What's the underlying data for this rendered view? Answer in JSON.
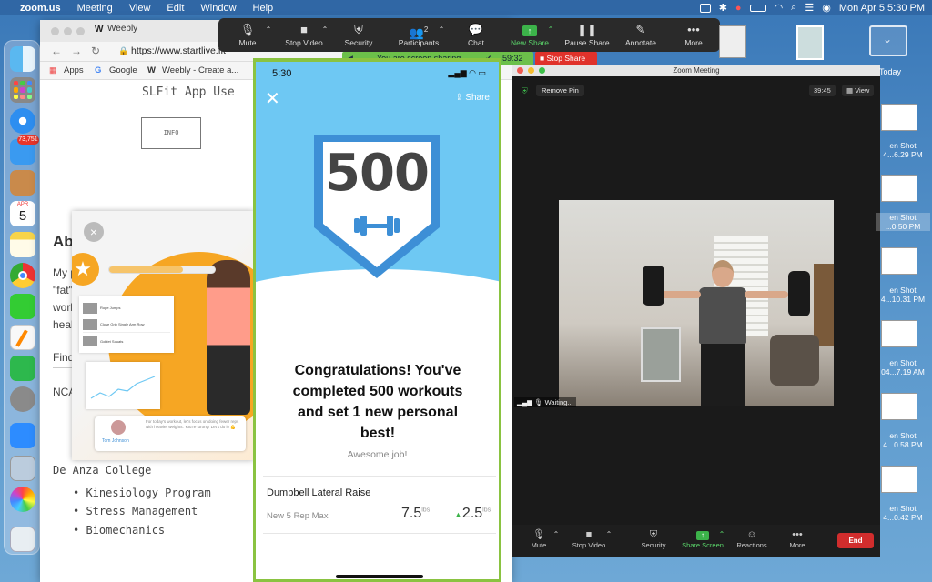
{
  "menubar": {
    "app_name": "zoom.us",
    "items": [
      "Meeting",
      "View",
      "Edit",
      "Window",
      "Help"
    ],
    "datetime": "Mon Apr 5  5:30 PM"
  },
  "dock": {
    "mail_badge": "73,751",
    "calendar_month": "APR",
    "calendar_day": "5"
  },
  "browser": {
    "tab_title": "Weebly",
    "url": "https://www.startlive.fit",
    "bookmarks": [
      "Apps",
      "Google",
      "Weebly - Create a..."
    ],
    "page": {
      "heading": "SLFit App Use",
      "info_button": "INFO",
      "about_fragment": "Ab",
      "body_fragments": [
        "My p",
        "\"fat\"",
        "work",
        "healt"
      ],
      "find_fragment": "Find",
      "ncaa_fragment": "NCAA",
      "college": "De Anza College",
      "programs": [
        "Kinesiology Program",
        "Stress Management",
        "Biomechanics"
      ]
    }
  },
  "popup": {
    "close": "×",
    "list_items": [
      "Rope Jumps",
      "Close Grip Single Arm Row",
      "Goblet Squats"
    ],
    "chat_text": "For today's workout, let's focus on doing fewer reps with heavier weights. You're strong! Let's do it! 💪",
    "trainer_name": "Tom Johnson"
  },
  "phone": {
    "time": "5:30",
    "share_label": "Share",
    "close_label": "✕",
    "badge_number": "500",
    "congrats_title": "Congratulations! You've completed 500 workouts and set 1 new personal best!",
    "subtitle": "Awesome job!",
    "exercise_name": "Dumbbell Lateral Raise",
    "metric_label": "New 5 Rep Max",
    "metric_value": "7.5",
    "metric_unit": "lbs",
    "change_value": "2.5",
    "change_unit": "lbs"
  },
  "zoom_toolbar": {
    "buttons": [
      "Mute",
      "Stop Video",
      "Security",
      "Participants",
      "Chat",
      "New Share",
      "Pause Share",
      "Annotate",
      "More"
    ],
    "participants_count": "2"
  },
  "share_bar": {
    "status": "You are screen sharing",
    "timer": "59:32",
    "stop_share": "Stop Share"
  },
  "zoom_window": {
    "title": "Zoom Meeting",
    "remove_pin": "Remove Pin",
    "timer": "39:45",
    "view_label": "View",
    "waiting_label": "Waiting...",
    "bottom_buttons": [
      "Mute",
      "Stop Video",
      "Security",
      "Share Screen",
      "Reactions",
      "More"
    ],
    "end_label": "End"
  },
  "desktop": {
    "today_label": "Today",
    "screenshots": [
      {
        "line1": "en Shot",
        "line2": "4...6.29 PM"
      },
      {
        "line1": "en Shot",
        "line2": "...0.50 PM"
      },
      {
        "line1": "en Shot",
        "line2": "4...10.31 PM"
      },
      {
        "line1": "en Shot",
        "line2": "04...7.19 AM"
      },
      {
        "line1": "en Shot",
        "line2": "4...0.58 PM"
      },
      {
        "line1": "en Shot",
        "line2": "4...0.42 PM"
      }
    ]
  },
  "colors": {
    "phone_blue": "#6ec8f3",
    "badge_blue": "#3d8fd6",
    "share_green": "#8ac341",
    "stop_red": "#e0322b",
    "end_red": "#d12d2d"
  }
}
